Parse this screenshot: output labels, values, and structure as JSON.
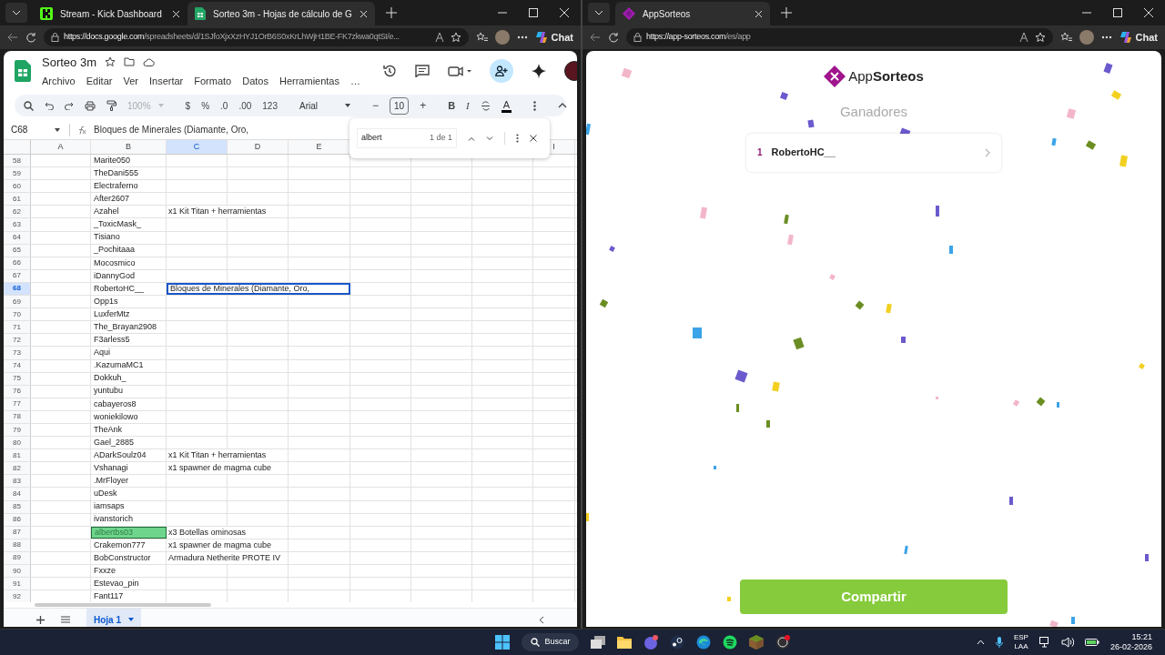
{
  "left_browser": {
    "tabs": [
      {
        "title": "Stream - Kick Dashboard",
        "selected": false,
        "kind": "kick"
      },
      {
        "title": "Sorteo 3m - Hojas de cálculo de G",
        "selected": true,
        "kind": "sheets"
      }
    ],
    "url_host": "https://docs.google.com",
    "url_path": "/spreadsheets/d/1SJfoXjxXzHYJ1OrB6S0xKrLhWjH1BE-FK7zkwa0qtSI/e...",
    "chat_label": "Chat"
  },
  "sheet": {
    "title": "Sorteo 3m",
    "menu": [
      "Archivo",
      "Editar",
      "Ver",
      "Insertar",
      "Formato",
      "Datos",
      "Herramientas",
      "…"
    ],
    "toolbar": {
      "zoom": "100%",
      "currency": "$",
      "percent": "%",
      "decrease_decimals": ".0",
      "increase_decimals": ".00",
      "number_format": "123",
      "font": "Arial",
      "font_size": "10",
      "minus": "−",
      "plus": "+",
      "bold": "B",
      "italic": "I",
      "text_color": "A"
    },
    "name_box": "C68",
    "formula": "Bloques de Minerales (Diamante, Oro,",
    "columns": [
      {
        "label": "A",
        "selected": false
      },
      {
        "label": "B",
        "selected": false
      },
      {
        "label": "C",
        "selected": true
      },
      {
        "label": "D",
        "selected": false
      },
      {
        "label": "E",
        "selected": false
      },
      {
        "label": "I",
        "selected": false
      }
    ],
    "rows": [
      {
        "number": "58",
        "b": "Marite050",
        "selected": false
      },
      {
        "number": "59",
        "b": "TheDani555",
        "selected": false
      },
      {
        "number": "60",
        "b": "Electraferno",
        "selected": false
      },
      {
        "number": "61",
        "b": "After2607",
        "selected": false
      },
      {
        "number": "62",
        "b": "Azahel",
        "c": "x1 Kit Titan + herramientas",
        "selected": false
      },
      {
        "number": "63",
        "b": "_ToxicMask_",
        "selected": false
      },
      {
        "number": "64",
        "b": "Tisiano",
        "selected": false
      },
      {
        "number": "65",
        "b": "_Pochitaaa",
        "selected": false
      },
      {
        "number": "66",
        "b": "Mocosmico",
        "selected": false
      },
      {
        "number": "67",
        "b": "iDannyGod",
        "selected": false
      },
      {
        "number": "68",
        "b": "RobertoHC__",
        "c": "Bloques de Minerales (Diamante, Oro,",
        "selected": true
      },
      {
        "number": "69",
        "b": "Opp1s",
        "selected": false
      },
      {
        "number": "70",
        "b": "LuxferMtz",
        "selected": false
      },
      {
        "number": "71",
        "b": "The_Brayan2908",
        "selected": false
      },
      {
        "number": "72",
        "b": "F3arless5",
        "selected": false
      },
      {
        "number": "73",
        "b": "Aqui",
        "selected": false
      },
      {
        "number": "74",
        "b": ".KazumaMC1",
        "selected": false
      },
      {
        "number": "75",
        "b": "Dokkuh_",
        "selected": false
      },
      {
        "number": "76",
        "b": "yuntubu",
        "selected": false
      },
      {
        "number": "77",
        "b": "cabayeros8",
        "selected": false
      },
      {
        "number": "78",
        "b": "woniekilowo",
        "selected": false
      },
      {
        "number": "79",
        "b": "TheAnk",
        "selected": false
      },
      {
        "number": "80",
        "b": "Gael_2885",
        "selected": false
      },
      {
        "number": "81",
        "b": "ADarkSoulz04",
        "c": "x1 Kit Titan + herramientas",
        "selected": false
      },
      {
        "number": "82",
        "b": "Vshanagi",
        "c": "x1 spawner de magma cube",
        "selected": false
      },
      {
        "number": "83",
        "b": ".MrFloyer",
        "selected": false
      },
      {
        "number": "84",
        "b": "uDesk",
        "selected": false
      },
      {
        "number": "85",
        "b": "iamsaps",
        "selected": false
      },
      {
        "number": "86",
        "b": "ivanstorich",
        "selected": false
      },
      {
        "number": "87",
        "b": "albertbs03",
        "c": "x3 Botellas ominosas",
        "selected": false,
        "match": true
      },
      {
        "number": "88",
        "b": "Crakemon777",
        "c": "x1 spawner de magma cube",
        "selected": false
      },
      {
        "number": "89",
        "b": "BobConstructor",
        "c": "Armadura Netherite PROTE IV",
        "selected": false
      },
      {
        "number": "90",
        "b": "Fxxze",
        "selected": false
      },
      {
        "number": "91",
        "b": "Estevao_pin",
        "selected": false
      },
      {
        "number": "92",
        "b": "Fant117",
        "selected": false
      }
    ],
    "find": {
      "query": "albert",
      "count": "1 de 1"
    },
    "sheet_tabs": [
      {
        "label": "Hoja 1",
        "selected": true
      }
    ]
  },
  "right_browser": {
    "tabs": [
      {
        "title": "AppSorteos",
        "selected": true,
        "kind": "appsorteos"
      }
    ],
    "url_host": "https://app-sorteos.com",
    "url_path": "/es/app",
    "chat_label": "Chat"
  },
  "app": {
    "logo": "App**Sorteos**",
    "heading": "Ganadores",
    "winners": [
      {
        "rank": "1",
        "name": "RobertoHC__"
      }
    ],
    "share_button": "Compartir"
  },
  "taskbar": {
    "search": "Buscar",
    "language": "ESP",
    "layout": "LAA",
    "time": "15:21",
    "date": "26-02-2026"
  }
}
